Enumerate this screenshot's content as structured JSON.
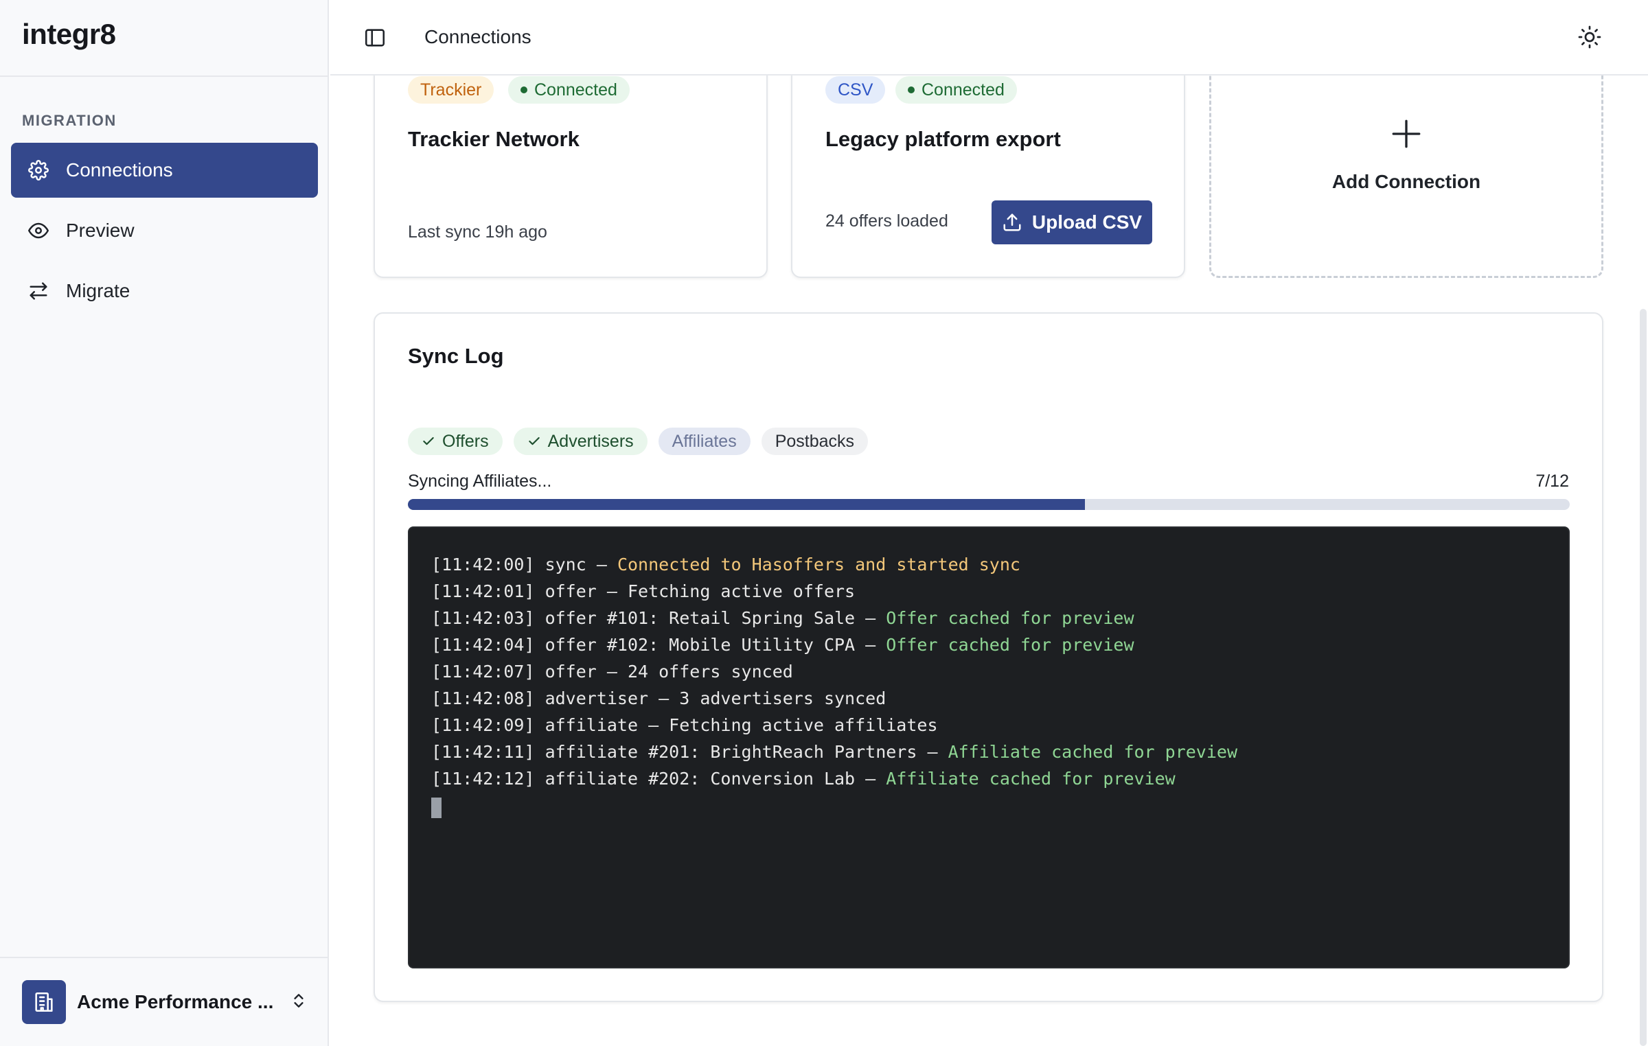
{
  "app": {
    "logo": "integr8",
    "page_title": "Connections"
  },
  "sidebar": {
    "section_label": "MIGRATION",
    "items": [
      {
        "label": "Connections",
        "icon": "gear-icon",
        "active": true
      },
      {
        "label": "Preview",
        "icon": "eye-icon",
        "active": false
      },
      {
        "label": "Migrate",
        "icon": "arrows-swap-icon",
        "active": false
      }
    ],
    "workspace": {
      "name": "Acme Performance ...",
      "icon": "building-icon"
    }
  },
  "connections": [
    {
      "type_badge": "Trackier",
      "status": "Connected",
      "title": "Trackier Network",
      "meta": "Last sync 19h ago"
    },
    {
      "type_badge": "CSV",
      "status": "Connected",
      "title": "Legacy platform export",
      "meta": "24 offers loaded",
      "action": "Upload CSV"
    }
  ],
  "add_connection": {
    "label": "Add Connection"
  },
  "sync_log": {
    "title": "Sync Log",
    "chips": [
      {
        "label": "Offers",
        "state": "done"
      },
      {
        "label": "Advertisers",
        "state": "done"
      },
      {
        "label": "Affiliates",
        "state": "active"
      },
      {
        "label": "Postbacks",
        "state": "pending"
      }
    ],
    "progress_label": "Syncing Affiliates...",
    "progress_count": "7/12",
    "progress_fraction": 0.583,
    "lines": [
      {
        "prefix": "[11:42:00] sync — ",
        "msg": "Connected to Hasoffers and started sync",
        "style": "warn"
      },
      {
        "prefix": "[11:42:01] offer — Fetching active offers",
        "msg": "",
        "style": "plain"
      },
      {
        "prefix": "[11:42:03] offer #101: Retail Spring Sale — ",
        "msg": "Offer cached for preview",
        "style": "ok"
      },
      {
        "prefix": "[11:42:04] offer #102: Mobile Utility CPA — ",
        "msg": "Offer cached for preview",
        "style": "ok"
      },
      {
        "prefix": "[11:42:07] offer — 24 offers synced",
        "msg": "",
        "style": "plain"
      },
      {
        "prefix": "[11:42:08] advertiser — 3 advertisers synced",
        "msg": "",
        "style": "plain"
      },
      {
        "prefix": "[11:42:09] affiliate — Fetching active affiliates",
        "msg": "",
        "style": "plain"
      },
      {
        "prefix": "[11:42:11] affiliate #201: BrightReach Partners — ",
        "msg": "Affiliate cached for preview",
        "style": "ok"
      },
      {
        "prefix": "[11:42:12] affiliate #202: Conversion Lab — ",
        "msg": "Affiliate cached for preview",
        "style": "ok"
      }
    ]
  },
  "colors": {
    "primary": "#34488c",
    "success": "#1e6b34",
    "terminal_bg": "#1d1f22",
    "terminal_ok": "#8fd694",
    "terminal_warn": "#f3c77a"
  }
}
